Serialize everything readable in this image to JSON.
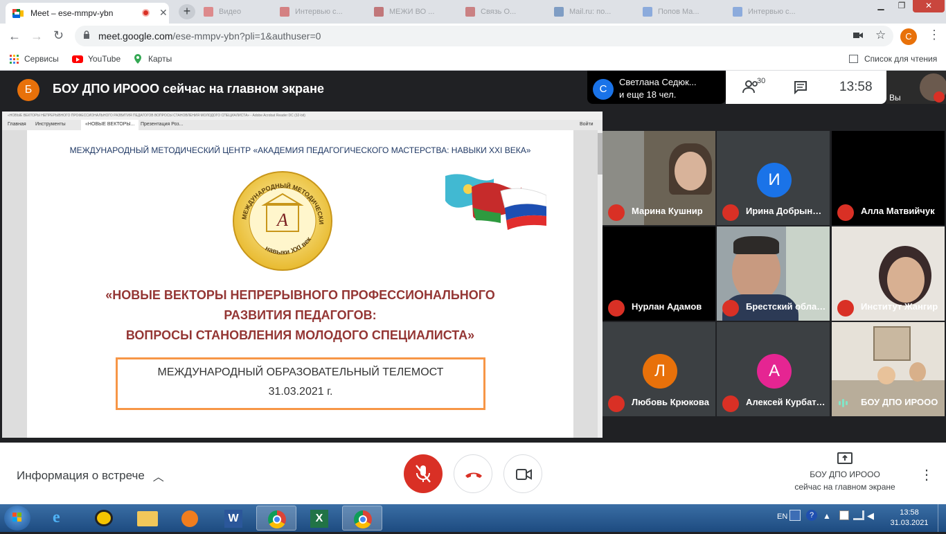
{
  "browser": {
    "active_tab_title": "Meet – ese-mmpv-ybn",
    "background_tabs": [
      "Видео",
      "Интервью с...",
      "МЕЖИ ВО ...",
      "Связь О...",
      "Mail.ru: по...",
      "Попов Ма...",
      "Интервью с..."
    ],
    "new_tab": "+",
    "url_host": "meet.google.com",
    "url_path": "/ese-mmpv-ybn?pli=1&authuser=0",
    "profile_initial": "С",
    "bookmarks": [
      "Сервисы",
      "YouTube",
      "Карты"
    ],
    "reading_list": "Список для чтения"
  },
  "meet": {
    "presenter_initial": "Б",
    "presenter_text": "БОУ ДПО ИРООО сейчас на главном экране",
    "chip_initial": "С",
    "chip_line1": "Светлана Седюк...",
    "chip_line2": "и еще 18 чел.",
    "people_count": "30",
    "clock": "13:58",
    "self_label": "Вы",
    "meeting_info": "Информация о встрече",
    "presenting_line1": "БОУ ДПО ИРООО",
    "presenting_line2": "сейчас на главном экране"
  },
  "slide": {
    "window_title": "«НОВЫЕ ВЕКТОРЫ НЕПРЕРЫВНОГО ПРОФЕССИОНАЛЬНОГО РАЗВИТИЯ ПЕДАГОГОВ ВОПРОСЫ СТАНОВЛЕНИЯ МОЛОДОГО СПЕЦИАЛИСТА» - Adobe Acrobat Reader DC (32-bit)",
    "menu_items": [
      "Главная",
      "Инструменты",
      "«НОВЫЕ ВЕКТОРЫ...",
      "Презентация Роз..."
    ],
    "signin": "Войти",
    "org_header": "МЕЖДУНАРОДНЫЙ МЕТОДИЧЕСКИЙ ЦЕНТР «АКАДЕМИЯ ПЕДАГОГИЧЕСКОГО МАСТЕРСТВА: НАВЫКИ XXI ВЕКА»",
    "seal_top": "МЕЖДУНАРОДНЫЙ МЕТОДИЧЕСКИЙ ЦЕНТР",
    "seal_bottom": "навыки XXI века",
    "seal_letter": "А",
    "title_line1": "«НОВЫЕ ВЕКТОРЫ НЕПРЕРЫВНОГО  ПРОФЕССИОНАЛЬНОГО",
    "title_line2": "РАЗВИТИЯ ПЕДАГОГОВ:",
    "title_line3": "ВОПРОСЫ СТАНОВЛЕНИЯ МОЛОДОГО  СПЕЦИАЛИСТА»",
    "box_line1": "МЕЖДУНАРОДНЫЙ ОБРАЗОВАТЕЛЬНЫЙ ТЕЛЕМОСТ",
    "box_line2": "31.03.2021 г."
  },
  "participants": [
    {
      "name": "Марина Кушнир",
      "initial": "",
      "color": ""
    },
    {
      "name": "Ирина Добрынина",
      "initial": "И",
      "color": "#1a73e8"
    },
    {
      "name": "Алла Матвийчук",
      "initial": "",
      "color": ""
    },
    {
      "name": "Нурлан Адамов",
      "initial": "",
      "color": ""
    },
    {
      "name": "Брестский областной",
      "initial": "",
      "color": ""
    },
    {
      "name": "Институт Жангир",
      "initial": "",
      "color": ""
    },
    {
      "name": "Любовь Крюкова",
      "initial": "Л",
      "color": "#e8710a"
    },
    {
      "name": "Алексей Курбатов",
      "initial": "А",
      "color": "#e52592"
    },
    {
      "name": "БОУ ДПО ИРООО",
      "initial": "",
      "color": ""
    }
  ],
  "taskbar": {
    "lang": "EN",
    "time": "13:58",
    "date": "31.03.2021"
  }
}
